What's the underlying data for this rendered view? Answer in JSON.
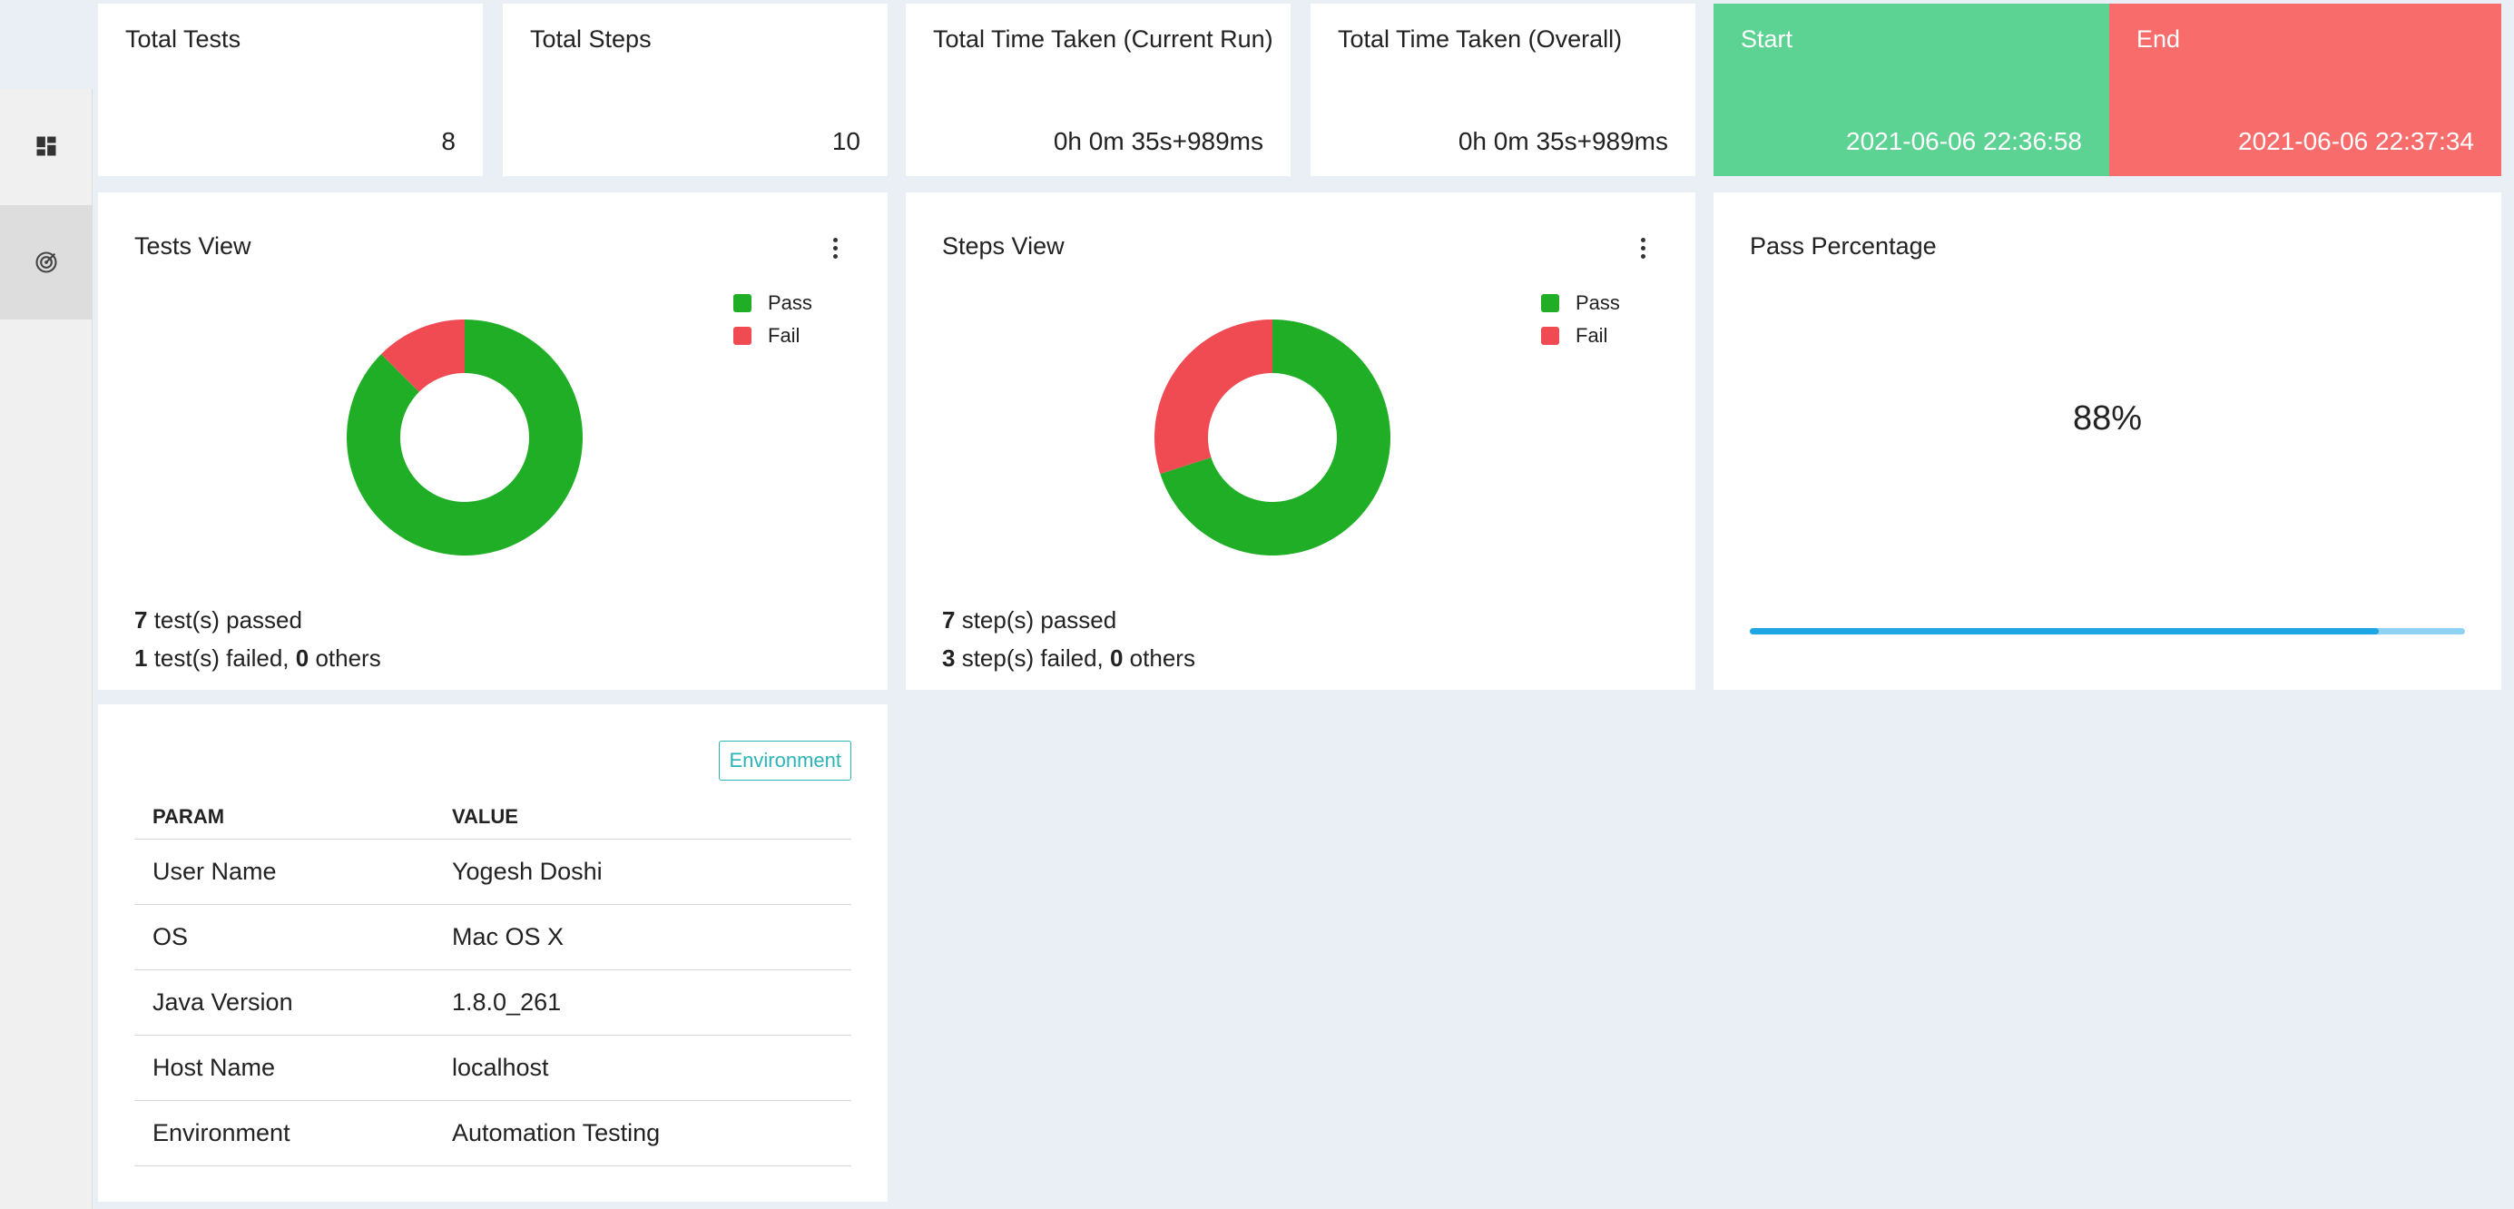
{
  "stats": [
    {
      "title": "Total Tests",
      "value": "8"
    },
    {
      "title": "Total Steps",
      "value": "10"
    },
    {
      "title": "Total Time Taken (Current Run)",
      "value": "0h 0m 35s+989ms"
    },
    {
      "title": "Total Time Taken (Overall)",
      "value": "0h 0m 35s+989ms"
    },
    {
      "title": "Start",
      "value": "2021-06-06 22:36:58"
    },
    {
      "title": "End",
      "value": "2021-06-06 22:37:34"
    }
  ],
  "tests_view": {
    "title": "Tests View",
    "legend": [
      {
        "label": "Pass",
        "color": "#1fae26"
      },
      {
        "label": "Fail",
        "color": "#f04a53"
      }
    ],
    "passed_count": "7",
    "passed_text": " test(s) passed",
    "failed_count": "1",
    "failed_text": " test(s) failed, ",
    "others_count": "0",
    "others_text": " others"
  },
  "steps_view": {
    "title": "Steps View",
    "legend": [
      {
        "label": "Pass",
        "color": "#1fae26"
      },
      {
        "label": "Fail",
        "color": "#f04a53"
      }
    ],
    "passed_count": "7",
    "passed_text": " step(s) passed",
    "failed_count": "3",
    "failed_text": " step(s) failed, ",
    "others_count": "0",
    "others_text": " others"
  },
  "pass_percentage": {
    "title": "Pass Percentage",
    "value_text": "88%",
    "progress": 0.88
  },
  "environment": {
    "badge": "Environment",
    "headers": [
      "PARAM",
      "VALUE"
    ],
    "rows": [
      [
        "User Name",
        "Yogesh Doshi"
      ],
      [
        "OS",
        "Mac OS X"
      ],
      [
        "Java Version",
        "1.8.0_261"
      ],
      [
        "Host Name",
        "localhost"
      ],
      [
        "Environment",
        "Automation Testing"
      ]
    ]
  },
  "chart_data": [
    {
      "type": "pie",
      "title": "Tests View",
      "categories": [
        "Pass",
        "Fail"
      ],
      "values": [
        7,
        1
      ],
      "colors": [
        "#1fae26",
        "#f04a53"
      ],
      "legend": "top-right"
    },
    {
      "type": "pie",
      "title": "Steps View",
      "categories": [
        "Pass",
        "Fail"
      ],
      "values": [
        7,
        3
      ],
      "colors": [
        "#1fae26",
        "#f04a53"
      ],
      "legend": "top-right"
    }
  ],
  "icons": {
    "sidebar_dashboard": "dashboard-icon",
    "sidebar_target": "target-icon"
  }
}
